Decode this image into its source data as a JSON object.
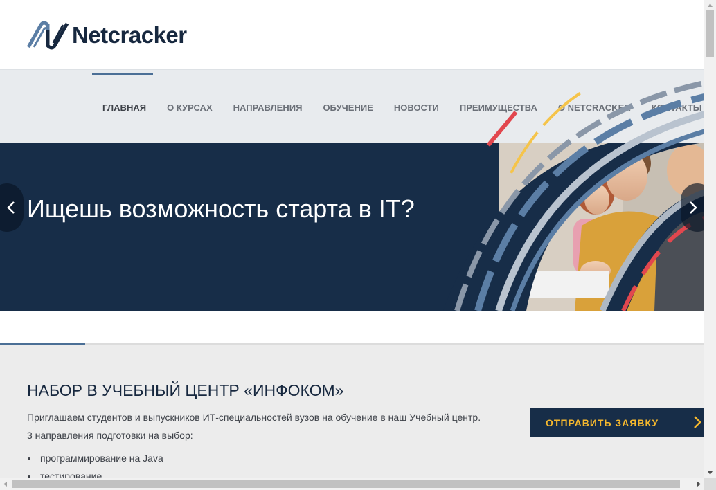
{
  "brand": {
    "name": "Netcracker",
    "mark_color": "#5b7ea5",
    "text_color": "#17283f"
  },
  "nav": {
    "items": [
      {
        "label": "ГЛАВНАЯ"
      },
      {
        "label": "О КУРСАХ"
      },
      {
        "label": "НАПРАВЛЕНИЯ"
      },
      {
        "label": "ОБУЧЕНИЕ"
      },
      {
        "label": "НОВОСТИ"
      },
      {
        "label": "ПРЕИМУЩЕСТВА"
      },
      {
        "label": "О NETCRACKER"
      },
      {
        "label": "КОНТАКТЫ"
      }
    ],
    "active": "ГЛАВНАЯ"
  },
  "hero": {
    "title": "Ищешь возможность старта в IT?",
    "prev_icon": "chevron-left-icon",
    "next_icon": "chevron-right-icon",
    "background_color": "#172d48"
  },
  "section": {
    "title": "НАБОР В УЧЕБНЫЙ ЦЕНТР «ИНФОКОМ»",
    "intro": "Приглашаем студентов и выпускников ИТ-специальностей вузов на обучение в наш Учебный центр.",
    "subtitle": "3 направления подготовки на выбор:",
    "list": [
      "программирование на Java",
      "тестирование"
    ],
    "cta_label": "ОТПРАВИТЬ ЗАЯВКУ",
    "cta_color": "#f5b82e"
  }
}
